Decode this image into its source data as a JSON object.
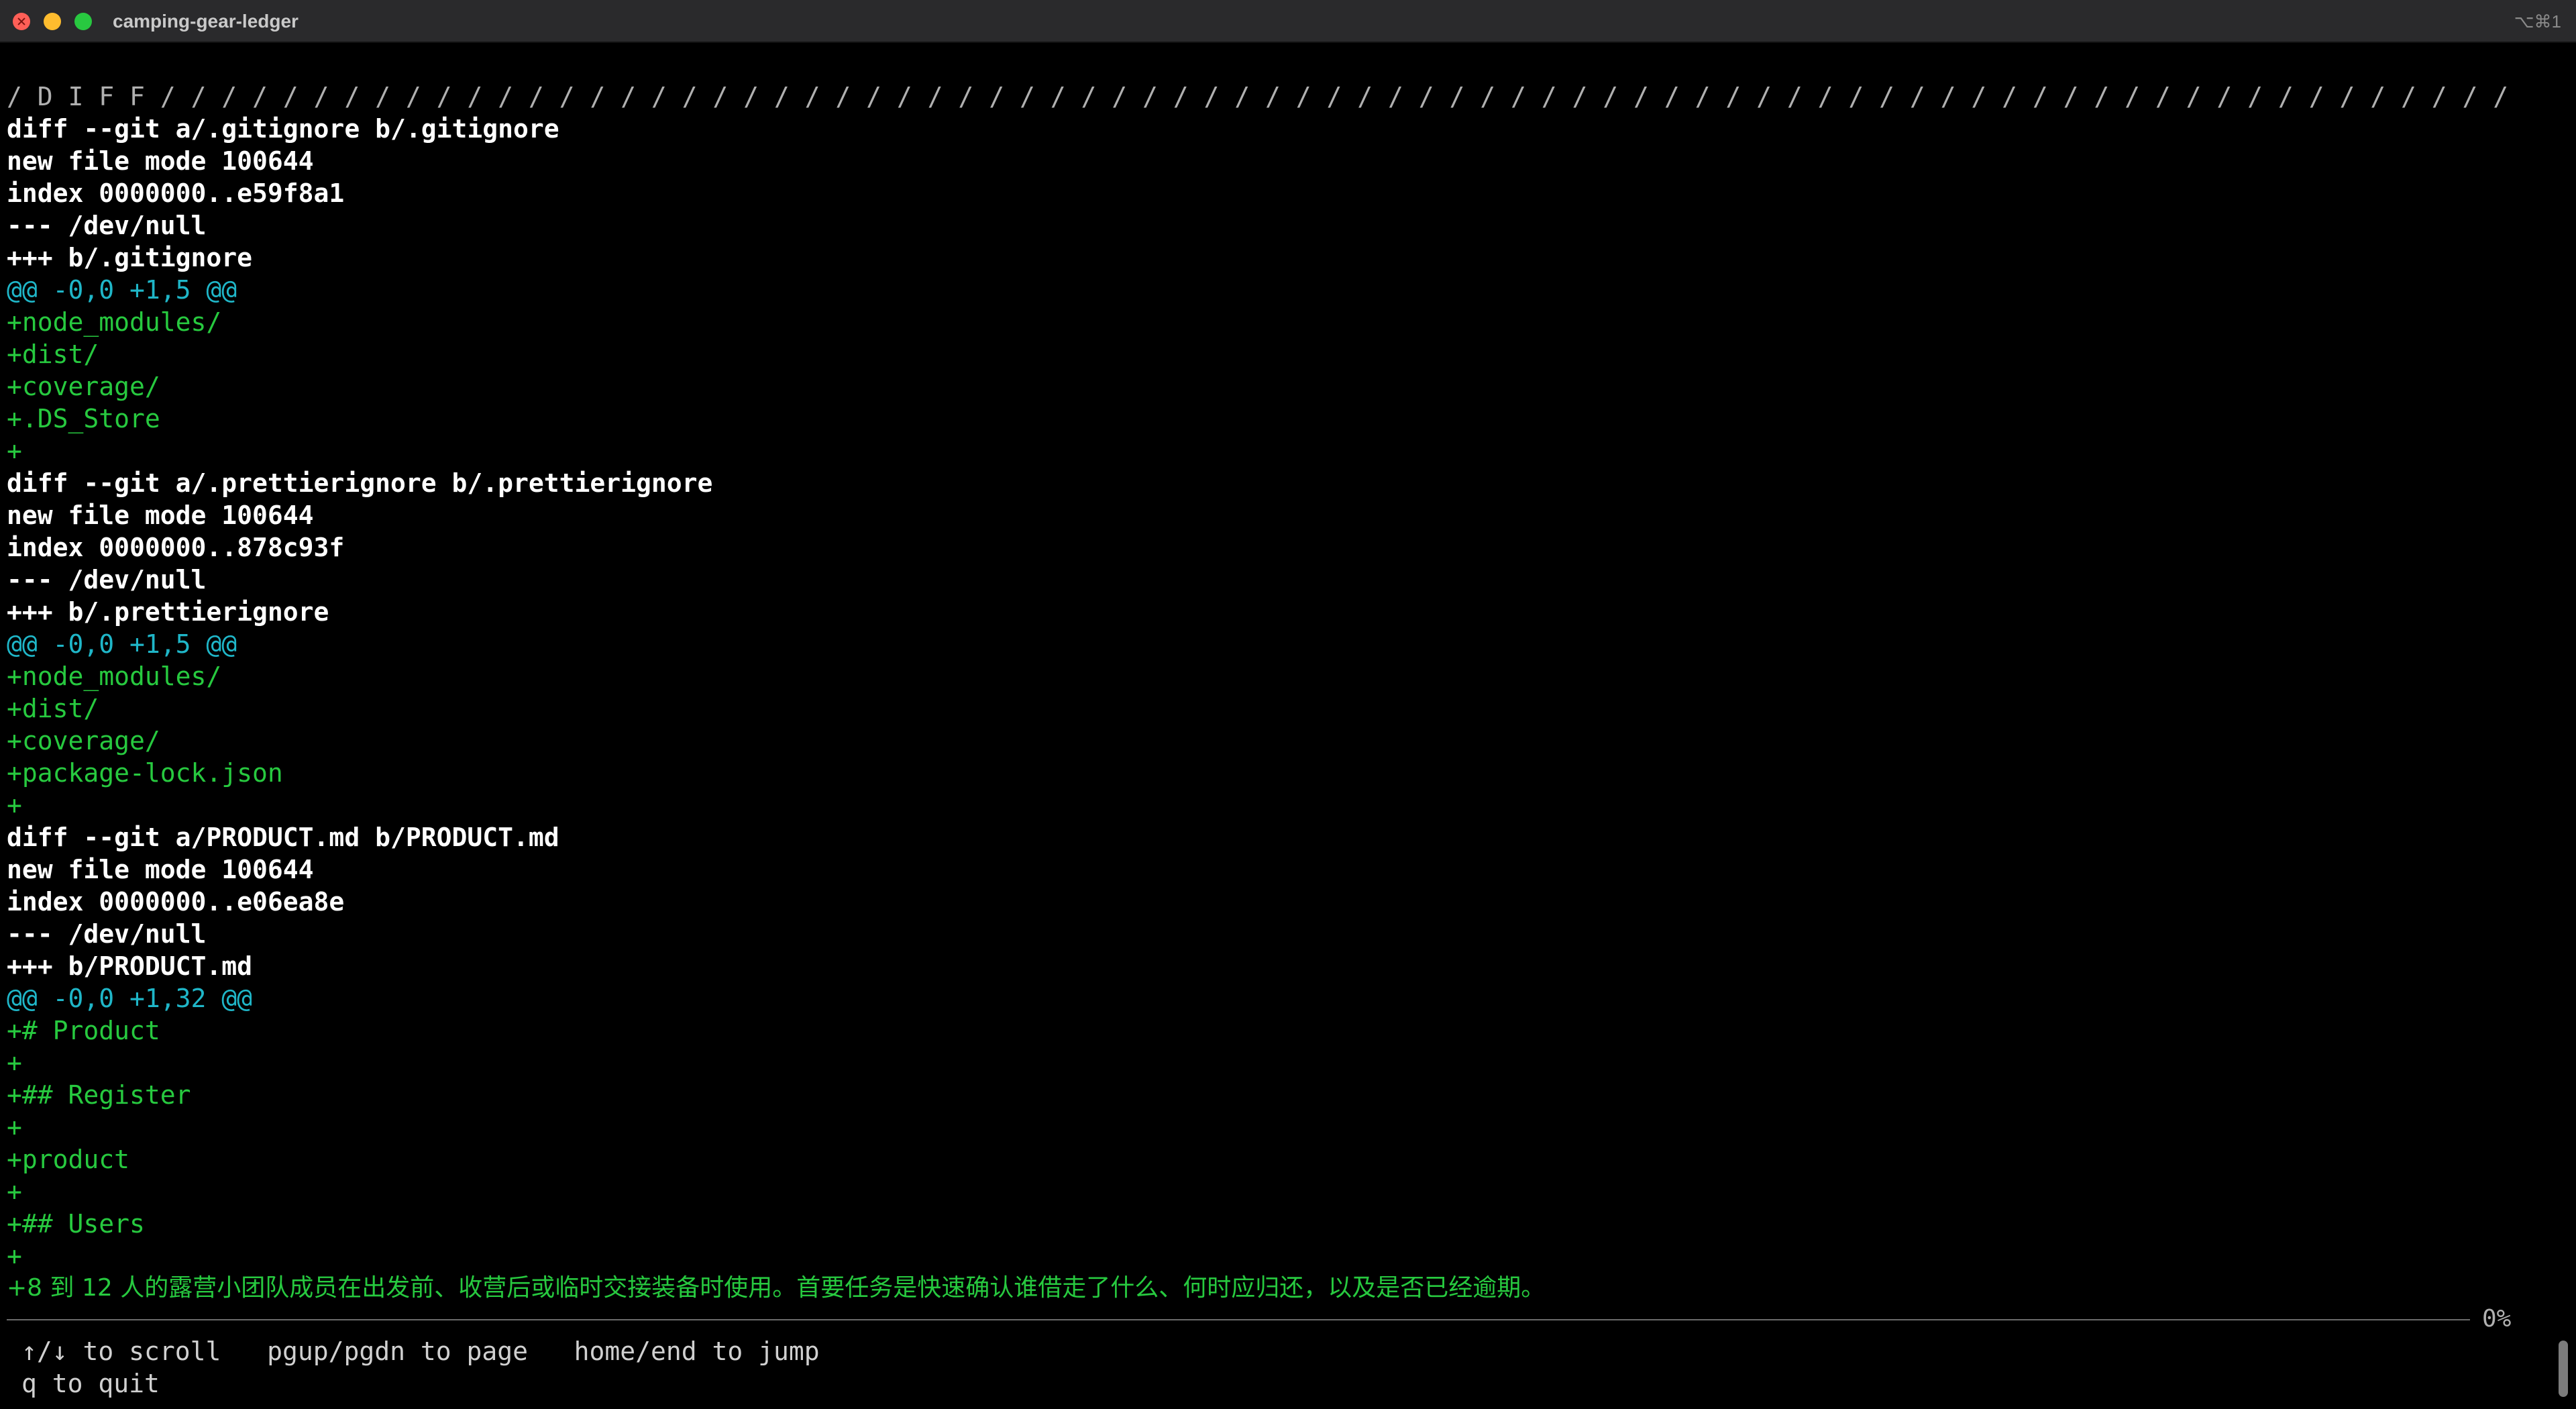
{
  "window": {
    "title": "camping-gear-ledger",
    "shortcut": "⌥⌘1"
  },
  "diff": {
    "separator": "/ D I F F / / / / / / / / / / / / / / / / / / / / / / / / / / / / / / / / / / / / / / / / / / / / / / / / / / / / / / / / / / / / / / / / / / / / / / / / / / / / / / / / / / / / / / / / / / / /",
    "lines": [
      {
        "type": "header",
        "text": "diff --git a/.gitignore b/.gitignore"
      },
      {
        "type": "header",
        "text": "new file mode 100644"
      },
      {
        "type": "header",
        "text": "index 0000000..e59f8a1"
      },
      {
        "type": "header",
        "text": "--- /dev/null"
      },
      {
        "type": "header",
        "text": "+++ b/.gitignore"
      },
      {
        "type": "hunk",
        "text": "@@ -0,0 +1,5 @@"
      },
      {
        "type": "added",
        "text": "+node_modules/"
      },
      {
        "type": "added",
        "text": "+dist/"
      },
      {
        "type": "added",
        "text": "+coverage/"
      },
      {
        "type": "added",
        "text": "+.DS_Store"
      },
      {
        "type": "added",
        "text": "+"
      },
      {
        "type": "header",
        "text": "diff --git a/.prettierignore b/.prettierignore"
      },
      {
        "type": "header",
        "text": "new file mode 100644"
      },
      {
        "type": "header",
        "text": "index 0000000..878c93f"
      },
      {
        "type": "header",
        "text": "--- /dev/null"
      },
      {
        "type": "header",
        "text": "+++ b/.prettierignore"
      },
      {
        "type": "hunk",
        "text": "@@ -0,0 +1,5 @@"
      },
      {
        "type": "added",
        "text": "+node_modules/"
      },
      {
        "type": "added",
        "text": "+dist/"
      },
      {
        "type": "added",
        "text": "+coverage/"
      },
      {
        "type": "added",
        "text": "+package-lock.json"
      },
      {
        "type": "added",
        "text": "+"
      },
      {
        "type": "header",
        "text": "diff --git a/PRODUCT.md b/PRODUCT.md"
      },
      {
        "type": "header",
        "text": "new file mode 100644"
      },
      {
        "type": "header",
        "text": "index 0000000..e06ea8e"
      },
      {
        "type": "header",
        "text": "--- /dev/null"
      },
      {
        "type": "header",
        "text": "+++ b/PRODUCT.md"
      },
      {
        "type": "hunk",
        "text": "@@ -0,0 +1,32 @@"
      },
      {
        "type": "added",
        "text": "+# Product"
      },
      {
        "type": "added",
        "text": "+"
      },
      {
        "type": "added",
        "text": "+## Register"
      },
      {
        "type": "added",
        "text": "+"
      },
      {
        "type": "added",
        "text": "+product"
      },
      {
        "type": "added",
        "text": "+"
      },
      {
        "type": "added",
        "text": "+## Users"
      },
      {
        "type": "added",
        "text": "+"
      },
      {
        "type": "added",
        "text": "+8 到 12 人的露营小团队成员在出发前、收营后或临时交接装备时使用。首要任务是快速确认谁借走了什么、何时应归还，以及是否已经逾期。"
      }
    ]
  },
  "status": {
    "percent": "0%"
  },
  "help": {
    "scroll": "↑/↓ to scroll",
    "page": "pgup/pgdn to page",
    "jump": "home/end to jump",
    "quit": "q to quit"
  }
}
